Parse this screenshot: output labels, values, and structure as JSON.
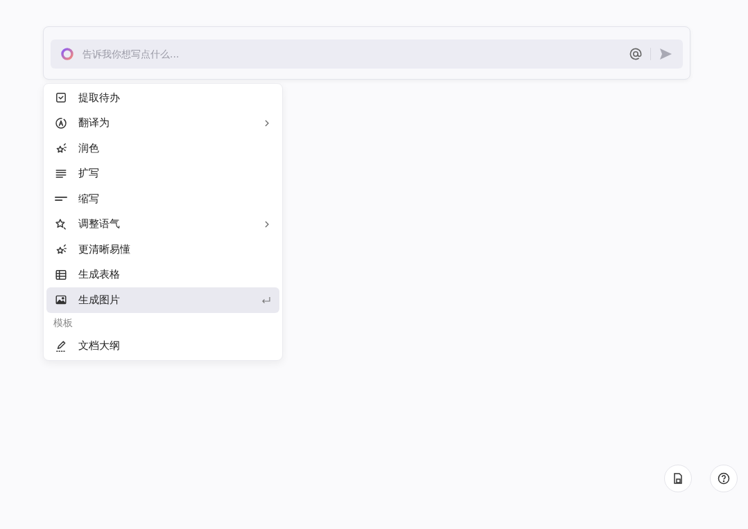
{
  "prompt_bar": {
    "placeholder": "告诉我你想写点什么..."
  },
  "menu": {
    "groups": [
      {
        "items": [
          {
            "label": "提取待办",
            "has_submenu": false,
            "selected": false
          },
          {
            "label": "翻译为",
            "has_submenu": true,
            "selected": false
          },
          {
            "label": "润色",
            "has_submenu": false,
            "selected": false
          },
          {
            "label": "扩写",
            "has_submenu": false,
            "selected": false
          },
          {
            "label": "缩写",
            "has_submenu": false,
            "selected": false
          },
          {
            "label": "调整语气",
            "has_submenu": true,
            "selected": false
          },
          {
            "label": "更清晰易懂",
            "has_submenu": false,
            "selected": false
          },
          {
            "label": "生成表格",
            "has_submenu": false,
            "selected": false
          },
          {
            "label": "生成图片",
            "has_submenu": false,
            "selected": true
          }
        ]
      },
      {
        "heading": "模板",
        "items": [
          {
            "label": "文档大纲",
            "has_submenu": false,
            "selected": false
          }
        ]
      }
    ]
  }
}
